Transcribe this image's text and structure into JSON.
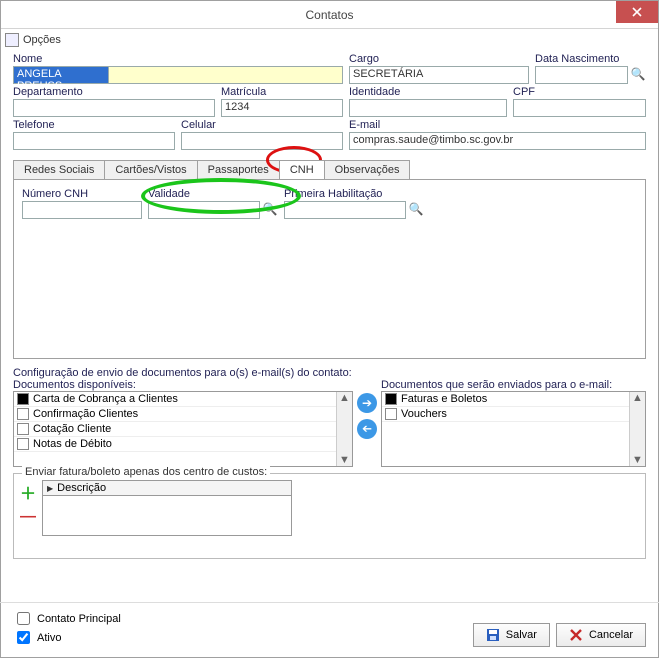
{
  "window": {
    "title": "Contatos"
  },
  "menu": {
    "opcoes": "Opções"
  },
  "fields": {
    "nome": {
      "label": "Nome",
      "value": "ANGELA PREUSS"
    },
    "cargo": {
      "label": "Cargo",
      "value": "SECRETÁRIA"
    },
    "data_nascimento": {
      "label": "Data Nascimento",
      "value": ""
    },
    "departamento": {
      "label": "Departamento",
      "value": ""
    },
    "matricula": {
      "label": "Matrícula",
      "value": "1234"
    },
    "identidade": {
      "label": "Identidade",
      "value": ""
    },
    "cpf": {
      "label": "CPF",
      "value": ""
    },
    "telefone": {
      "label": "Telefone",
      "value": ""
    },
    "celular": {
      "label": "Celular",
      "value": ""
    },
    "email": {
      "label": "E-mail",
      "value": "compras.saude@timbo.sc.gov.br"
    }
  },
  "tabs": {
    "redes": "Redes Sociais",
    "cartoes": "Cartões/Vistos",
    "passaportes": "Passaportes",
    "cnh": "CNH",
    "observacoes": "Observações",
    "active": "cnh"
  },
  "cnh": {
    "numero": {
      "label": "Número CNH",
      "value": ""
    },
    "validade": {
      "label": "Validade",
      "value": ""
    },
    "primeira": {
      "label": "Primeira Habilitação",
      "value": ""
    }
  },
  "docs": {
    "header": "Configuração de envio de documentos para o(s) e-mail(s) do contato:",
    "left_label": "Documentos disponíveis:",
    "right_label": "Documentos que serão enviados para o e-mail:",
    "available": [
      "Carta de Cobrança a Clientes",
      "Confirmação Clientes",
      "Cotação Cliente",
      "Notas de Débito"
    ],
    "selected": [
      "Faturas e Boletos",
      "Vouchers"
    ]
  },
  "cc": {
    "legend": "Enviar fatura/boleto apenas dos centro de custos:",
    "col": "Descrição"
  },
  "footer": {
    "contato_principal": "Contato Principal",
    "ativo": "Ativo",
    "ativo_checked": true,
    "salvar": "Salvar",
    "cancelar": "Cancelar"
  },
  "icons": {
    "save_color": "#2a5fbf",
    "cancel_color": "#c62828"
  }
}
